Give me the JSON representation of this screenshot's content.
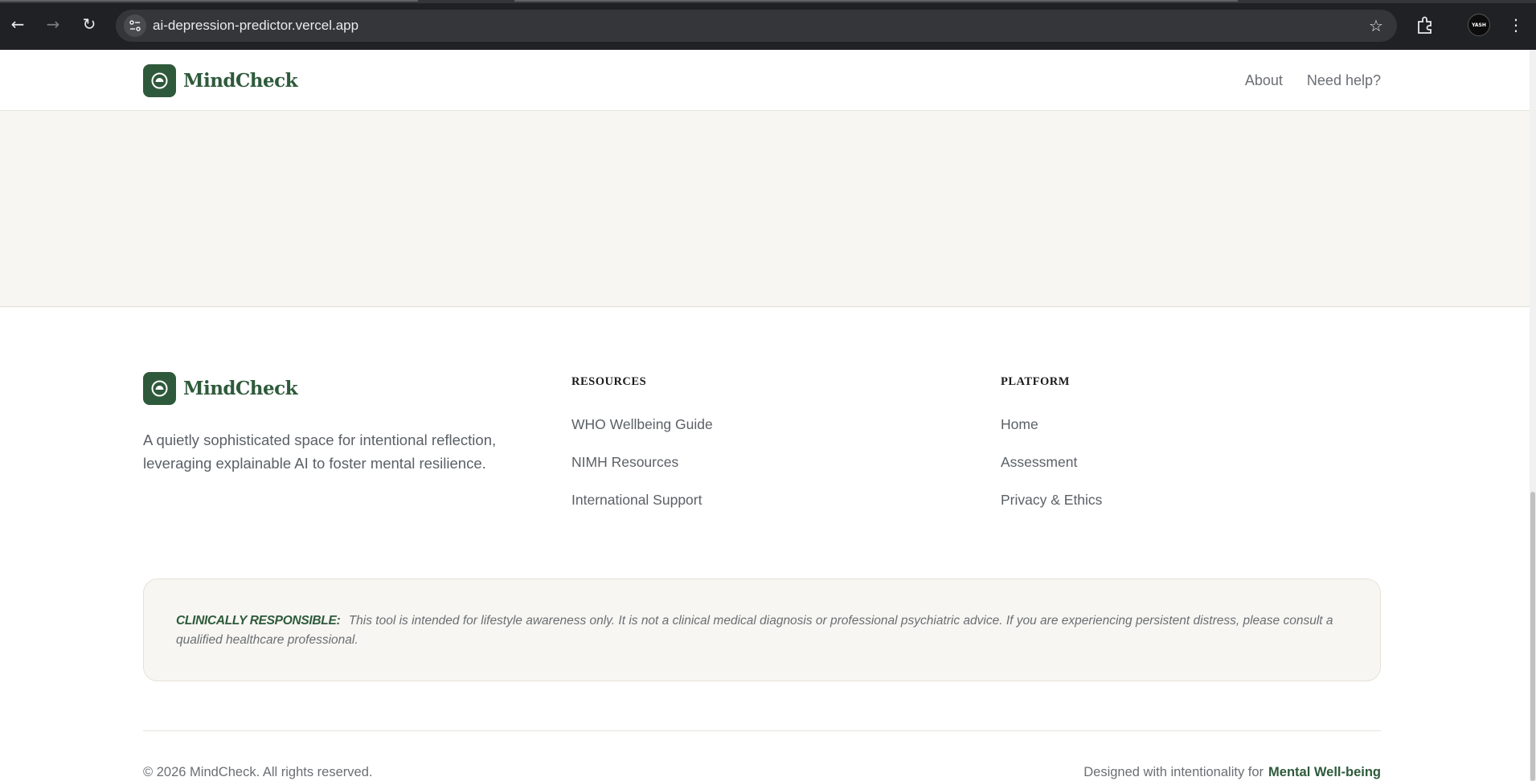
{
  "browser": {
    "url": "ai-depression-predictor.vercel.app",
    "profile_badge": "YASH"
  },
  "site": {
    "brand_name": "MindCheck",
    "nav": {
      "about": "About",
      "help": "Need help?"
    }
  },
  "footer": {
    "tagline": "A quietly sophisticated space for intentional reflection, leveraging explainable AI to foster mental resilience.",
    "resources": {
      "heading": "RESOURCES",
      "links": [
        "WHO Wellbeing Guide",
        "NIMH Resources",
        "International Support"
      ]
    },
    "platform": {
      "heading": "PLATFORM",
      "links": [
        "Home",
        "Assessment",
        "Privacy & Ethics"
      ]
    },
    "disclaimer": {
      "label": "CLINICALLY RESPONSIBLE:",
      "text": "This tool is intended for lifestyle awareness only. It is not a clinical medical diagnosis or professional psychiatric advice. If you are experiencing persistent distress, please consult a qualified healthcare professional."
    },
    "copyright": "© 2026 MindCheck. All rights reserved.",
    "designed_prefix": "Designed with intentionality for",
    "designed_accent": "Mental Well-being"
  },
  "colors": {
    "brand_green": "#2e5a3b",
    "page_bg": "#f7f6f2",
    "chrome_bg": "#202124"
  }
}
